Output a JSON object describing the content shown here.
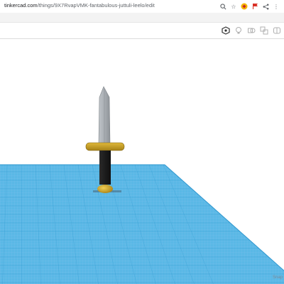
{
  "browser": {
    "url_host": "tinkercad.com",
    "url_path": "/things/9X7RvapVMK-fantabulous-juttuli-leelo/edit",
    "icons": [
      "zoom-icon",
      "star-icon",
      "extension-icon",
      "flag-icon",
      "share-icon",
      "more-icon"
    ]
  },
  "toolbar": {
    "tools": [
      "view-cube-icon",
      "light-bulb-icon",
      "shape-icon",
      "group-icon",
      "mirror-icon"
    ]
  },
  "workplane": {
    "corner_label": "Snap",
    "grid_color": "#5ab8e6",
    "grid_line_color": "#2f97cf"
  },
  "model": {
    "blade_color": "#a9aeb3",
    "guard_color": "#c8a126",
    "handle_color": "#1f1f1f",
    "pommel_color": "#d4ad2e"
  }
}
